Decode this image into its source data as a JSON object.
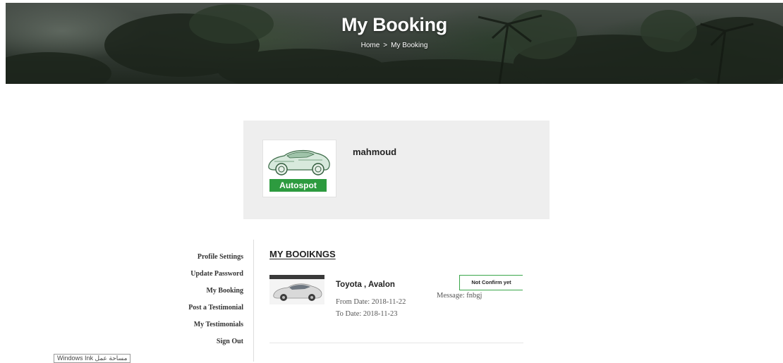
{
  "hero": {
    "title": "My Booking",
    "breadcrumb": {
      "home": "Home",
      "separator": ">",
      "current": "My Booking"
    }
  },
  "profile": {
    "brand_badge": "Autospot",
    "username": "mahmoud"
  },
  "sidebar": {
    "items": [
      {
        "label": "Profile Settings"
      },
      {
        "label": "Update Password"
      },
      {
        "label": "My Booking"
      },
      {
        "label": "Post a Testimonial"
      },
      {
        "label": "My Testimonials"
      },
      {
        "label": "Sign Out"
      }
    ]
  },
  "bookings": {
    "heading": "MY BOOIKNGS",
    "items": [
      {
        "car": "Toyota , Avalon",
        "from_label": "From Date:",
        "from_value": "2018-11-22",
        "to_label": "To Date:",
        "to_value": "2018-11-23",
        "status": "Not Confirm yet",
        "message_label": "Message:",
        "message_value": "fnbgj"
      }
    ]
  },
  "ink_tooltip": "Windows Ink مساحة عمل",
  "colors": {
    "accent_green": "#2d9b3f",
    "card_bg": "#eeeeee"
  }
}
